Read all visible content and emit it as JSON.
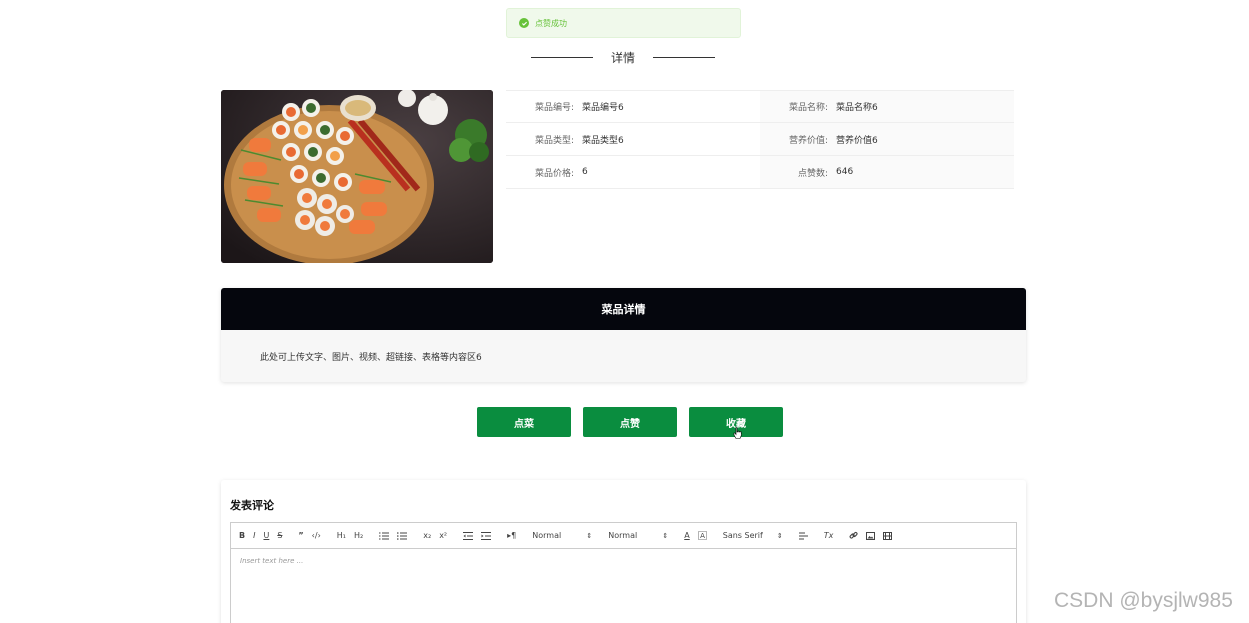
{
  "toast": {
    "text": "点赞成功",
    "icon": "check-circle-icon",
    "color": "#67c23a"
  },
  "section_title": "详情",
  "dish": {
    "image_alt": "sushi platter",
    "fields": [
      [
        {
          "label": "菜品编号:",
          "value": "菜品编号6"
        },
        {
          "label": "菜品名称:",
          "value": "菜品名称6"
        }
      ],
      [
        {
          "label": "菜品类型:",
          "value": "菜品类型6"
        },
        {
          "label": "营养价值:",
          "value": "营养价值6"
        }
      ],
      [
        {
          "label": "菜品价格:",
          "value": "6"
        },
        {
          "label": "点赞数:",
          "value": "646"
        }
      ]
    ]
  },
  "detail": {
    "header": "菜品详情",
    "body": "此处可上传文字、图片、视频、超链接、表格等内容区6"
  },
  "buttons": {
    "order": "点菜",
    "like": "点赞",
    "favorite": "收藏",
    "color": "#0a8d3f"
  },
  "comment": {
    "title": "发表评论",
    "toolbar": {
      "bold": "B",
      "italic": "I",
      "underline": "U",
      "strike": "S",
      "quote": "”",
      "code": "‹/›",
      "h1": "H₁",
      "h2": "H₂",
      "sub": "x₂",
      "sup": "x²",
      "direction": "▸¶",
      "size_value": "Normal",
      "header_value": "Normal",
      "color_a": "A",
      "font_value": "Sans Serif",
      "clean": "Tx"
    },
    "placeholder": "Insert text here ..."
  },
  "watermark": "CSDN @bysjlw985"
}
